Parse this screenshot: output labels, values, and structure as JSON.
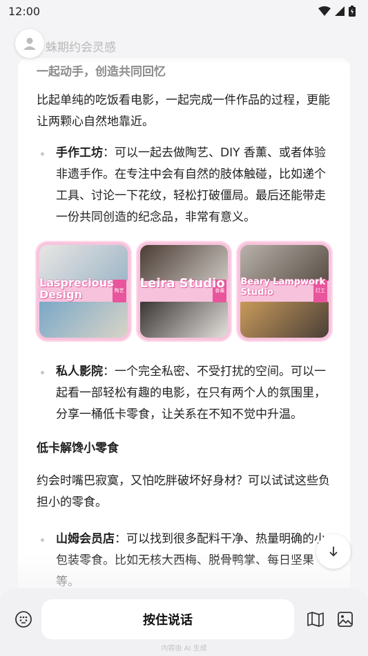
{
  "status": {
    "time": "12:00"
  },
  "header": {
    "title": "蛛期约会灵感"
  },
  "content": {
    "subheading": "一起动手，创造共同回忆",
    "intro": "比起单纯的吃饭看电影，一起完成一件作品的过程，更能让两颗心自然地靠近。",
    "items1": [
      {
        "title": "手作工坊",
        "text": "：可以一起去做陶艺、DIY 香薰、或者体验非遗手作。在专注中会有自然的肢体触碰，比如递个工具、讨论一下花纹，轻松打破僵局。最后还能带走一份共同创造的纪念品，非常有意义。"
      }
    ],
    "images": [
      {
        "label": "Lasprecious Design",
        "tag": "陶艺"
      },
      {
        "label": "Leira Studio",
        "tag": "香薰"
      },
      {
        "label": "Beary Lampwork Studio",
        "tag": "灯工"
      }
    ],
    "items2": [
      {
        "title": "私人影院",
        "text": "：一个完全私密、不受打扰的空间。可以一起看一部轻松有趣的电影，在只有两个人的氛围里，分享一桶低卡零食，让关系在不知不觉中升温。"
      }
    ],
    "section2_title": "低卡解馋小零食",
    "section2_intro": "约会时嘴巴寂寞，又怕吃胖破坏好身材？可以试试这些负担小的零食。",
    "items3": [
      {
        "title": "山姆会员店",
        "text": "：可以找到很多配料干净、热量明确的小包装零食。比如无核大西梅、脱骨鸭掌、每日坚果等。"
      }
    ]
  },
  "bottom": {
    "voice_label": "按住说话",
    "footer": "内容由 AI 生成"
  },
  "icons": [
    "avatar-icon",
    "wifi-icon",
    "signal-icon",
    "battery-icon",
    "arrow-down-icon",
    "emoji-icon",
    "map-icon",
    "image-icon"
  ]
}
